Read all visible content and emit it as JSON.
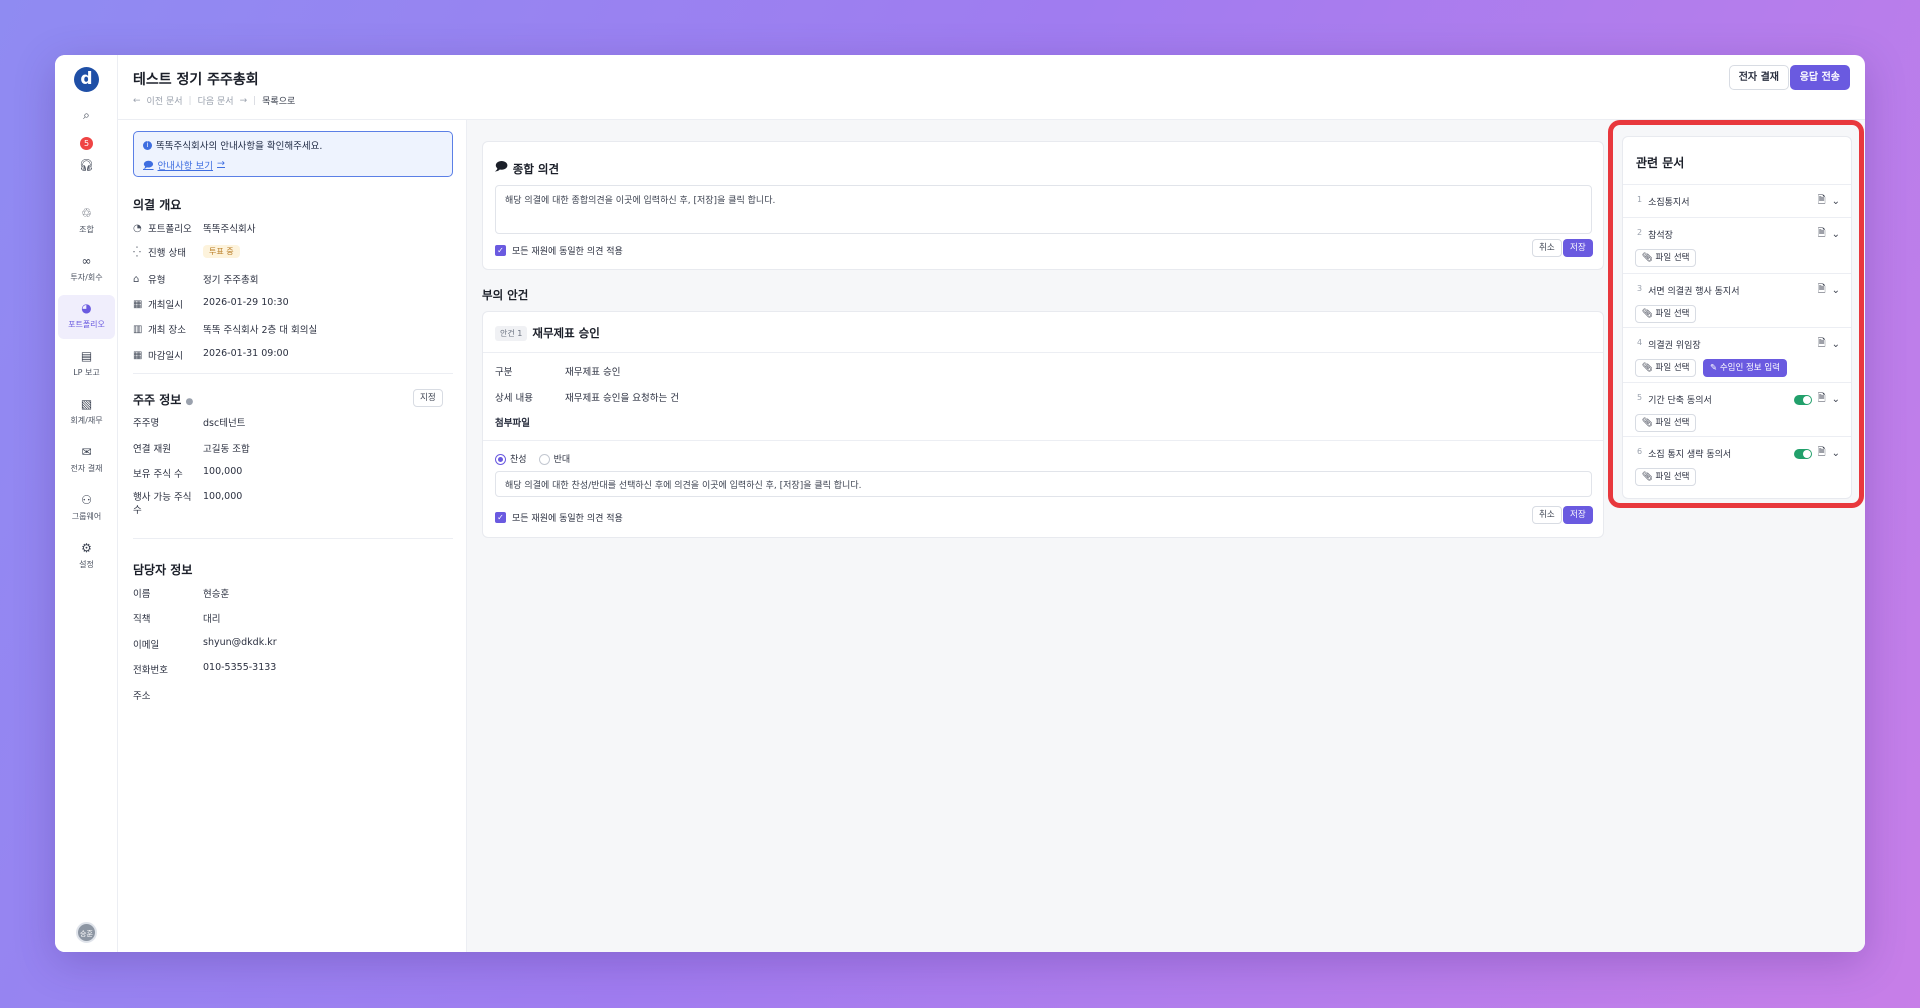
{
  "colors": {
    "accent": "#6a5ae0",
    "highlight": "#e8383d",
    "brand_logo": "#1f4fa6"
  },
  "header": {
    "title": "테스트 정기 주주총회",
    "prev_doc": "이전 문서",
    "next_doc": "다음 문서",
    "back_to_list": "목록으로",
    "sign_button": "전자 결재",
    "send_button": "응답 전송"
  },
  "sidebar": {
    "logo": "d",
    "notification_count": "5",
    "items": [
      {
        "label": "조합",
        "icon": "recycle-icon"
      },
      {
        "label": "투자/회수",
        "icon": "links-icon"
      },
      {
        "label": "포트폴리오",
        "icon": "pie-icon"
      },
      {
        "label": "LP 보고",
        "icon": "document-icon"
      },
      {
        "label": "회계/재무",
        "icon": "document-dollar-icon"
      },
      {
        "label": "전자 결재",
        "icon": "inbox-icon"
      },
      {
        "label": "그룹웨어",
        "icon": "group-icon"
      },
      {
        "label": "설정",
        "icon": "settings-icon"
      }
    ],
    "avatar": "승훈"
  },
  "notice": {
    "text": "똑똑주식회사의 안내사항을 확인해주세요.",
    "link": "안내사항 보기"
  },
  "overview": {
    "title": "의결 개요",
    "rows": [
      {
        "key": "포트폴리오",
        "value": "똑똑주식회사"
      },
      {
        "key": "진행 상태",
        "value": "투표 중"
      },
      {
        "key": "유형",
        "value": "정기 주주총회"
      },
      {
        "key": "개최일시",
        "value": "2026-01-29 10:30"
      },
      {
        "key": "개최 장소",
        "value": "똑똑 주식회사 2층 대 회의실"
      },
      {
        "key": "마감일시",
        "value": "2026-01-31 09:00"
      }
    ]
  },
  "shareholder": {
    "title": "주주 정보",
    "assign_button": "지정",
    "rows": [
      {
        "key": "주주명",
        "value": "dsc테넌트"
      },
      {
        "key": "연결 재원",
        "value": "고길동 조합"
      },
      {
        "key": "보유 주식 수",
        "value": "100,000"
      },
      {
        "key": "행사 가능 주식 수",
        "value": "100,000"
      }
    ]
  },
  "manager": {
    "title": "담당자 정보",
    "rows": [
      {
        "key": "이름",
        "value": "현승훈"
      },
      {
        "key": "직책",
        "value": "대리"
      },
      {
        "key": "이메일",
        "value": "shyun@dkdk.kr"
      },
      {
        "key": "전화번호",
        "value": "010-5355-3133"
      },
      {
        "key": "주소",
        "value": ""
      }
    ]
  },
  "overall_opinion": {
    "title": "종합 의견",
    "placeholder": "해당 의결에 대한 종합의견을 이곳에 입력하신 후, [저장]을 클릭 합니다.",
    "apply_all": "모든 재원에 동일한 의견 적용",
    "cancel": "취소",
    "save": "저장"
  },
  "agenda": {
    "section_title": "부의 안건",
    "badge": "안건 1",
    "title": "재무제표 승인",
    "rows": [
      {
        "key": "구분",
        "value": "재무제표 승인"
      },
      {
        "key": "상세 내용",
        "value": "재무제표 승인을 요청하는 건"
      },
      {
        "key": "첨부파일",
        "value": ""
      }
    ],
    "vote_for": "찬성",
    "vote_against": "반대",
    "placeholder": "해당 의결에 대한 찬성/반대를 선택하신 후에 의견을 이곳에 입력하신 후, [저장]을 클릭 합니다.",
    "apply_all": "모든 재원에 동일한 의견 적용",
    "cancel": "취소",
    "save": "저장"
  },
  "related_docs": {
    "title": "관련 문서",
    "file_button": "파일 선택",
    "proxy_button": "수임인 정보 입력",
    "items": [
      {
        "num": "1",
        "name": "소집통지서"
      },
      {
        "num": "2",
        "name": "참석장"
      },
      {
        "num": "3",
        "name": "서면 의결권 행사 동지서"
      },
      {
        "num": "4",
        "name": "의결권 위임장"
      },
      {
        "num": "5",
        "name": "기간 단축 동의서"
      },
      {
        "num": "6",
        "name": "소집 통지 생략 동의서"
      }
    ]
  }
}
